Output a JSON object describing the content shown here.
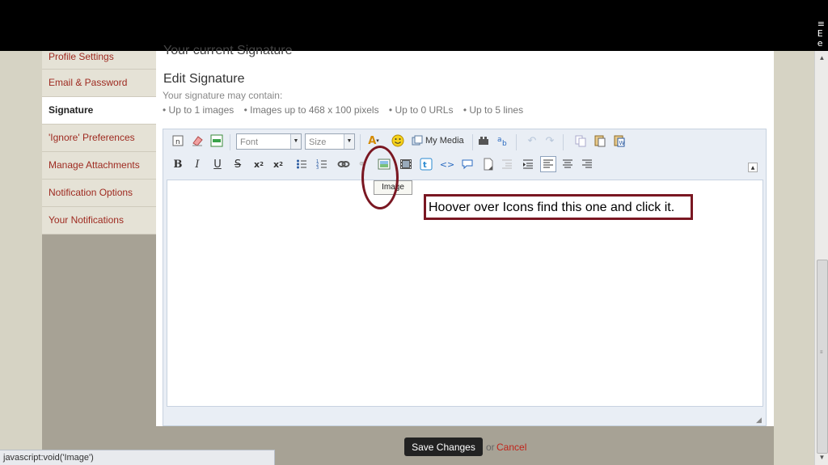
{
  "window": {
    "edge_glyphs": "≡\nE\ne"
  },
  "sidebar": {
    "items": [
      {
        "label": "Profile Settings"
      },
      {
        "label": "Email & Password"
      },
      {
        "label": "Signature",
        "active": true
      },
      {
        "label": "'Ignore' Preferences"
      },
      {
        "label": "Manage Attachments"
      },
      {
        "label": "Notification Options"
      },
      {
        "label": "Your Notifications"
      }
    ]
  },
  "main": {
    "current_signature_heading": "Your current Signature",
    "edit_heading": "Edit Signature",
    "may_contain": "Your signature may contain:",
    "rules": [
      "• Up to 1 images",
      "• Images up to 468 x 100 pixels",
      "• Up to 0 URLs",
      "• Up to 5 lines"
    ]
  },
  "toolbar": {
    "font_placeholder": "Font",
    "size_placeholder": "Size",
    "my_media_label": "My Media",
    "image_tooltip": "Image",
    "row1_icons": [
      "source-icon",
      "eraser-icon",
      "toggle-wysiwyg-icon",
      "text-color-icon",
      "smiley-icon",
      "my-media-icon",
      "spellcheck-icon",
      "translate-icon",
      "undo-icon",
      "redo-icon",
      "copy-icon",
      "paste-icon",
      "paste-word-icon"
    ],
    "row2_icons": [
      "bold-icon",
      "italic-icon",
      "underline-icon",
      "strikethrough-icon",
      "subscript-icon",
      "superscript-icon",
      "bullet-list-icon",
      "numbered-list-icon",
      "link-icon",
      "unlink-icon",
      "image-icon",
      "video-icon",
      "twitter-icon",
      "code-icon",
      "quote-icon",
      "page-icon",
      "indent-icon",
      "outdent-icon",
      "align-left-icon",
      "align-center-icon",
      "align-right-icon",
      "collapse-icon"
    ]
  },
  "annotation": {
    "callout_text": "Hoover over Icons find this one and click it.",
    "ellipse_color": "#7a1722",
    "callout_border_color": "#7a1722"
  },
  "footer": {
    "save_label": "Save Changes",
    "or_text": "or",
    "cancel_label": "Cancel"
  },
  "statusbar": {
    "text": "javascript:void('Image')"
  },
  "colors": {
    "link_red": "#9e2a20",
    "cancel_red": "#c0241a",
    "sidebar_bg": "#a7a295",
    "page_bg": "#d6d3c4",
    "editor_bg": "#e9eef5"
  }
}
